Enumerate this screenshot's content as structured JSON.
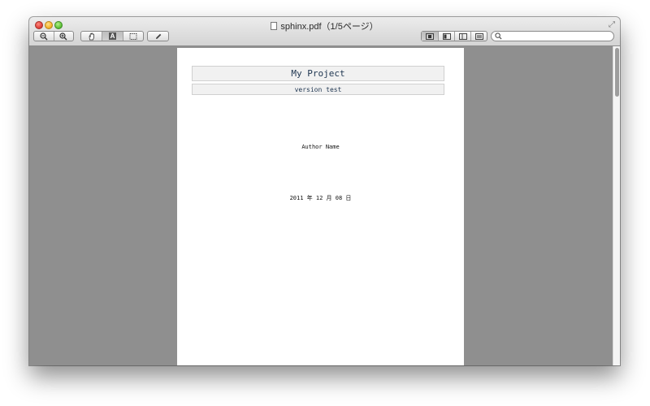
{
  "window": {
    "title": "sphinx.pdf（1/5ページ）"
  },
  "toolbar": {
    "zoom_out": "zoom-out-icon",
    "zoom_in": "zoom-in-icon",
    "pan": "hand-icon",
    "text_select": "A",
    "rect_select": "marquee-select-icon",
    "annotate": "pencil-icon",
    "view_modes": [
      "single-page-view-icon",
      "sidebar-left-view-icon",
      "sidebar-split-view-icon",
      "continuous-view-icon"
    ],
    "search_placeholder": ""
  },
  "document": {
    "title": "My Project",
    "version": "version test",
    "author": "Author Name",
    "date": "2011 年 12 月 08 日"
  }
}
